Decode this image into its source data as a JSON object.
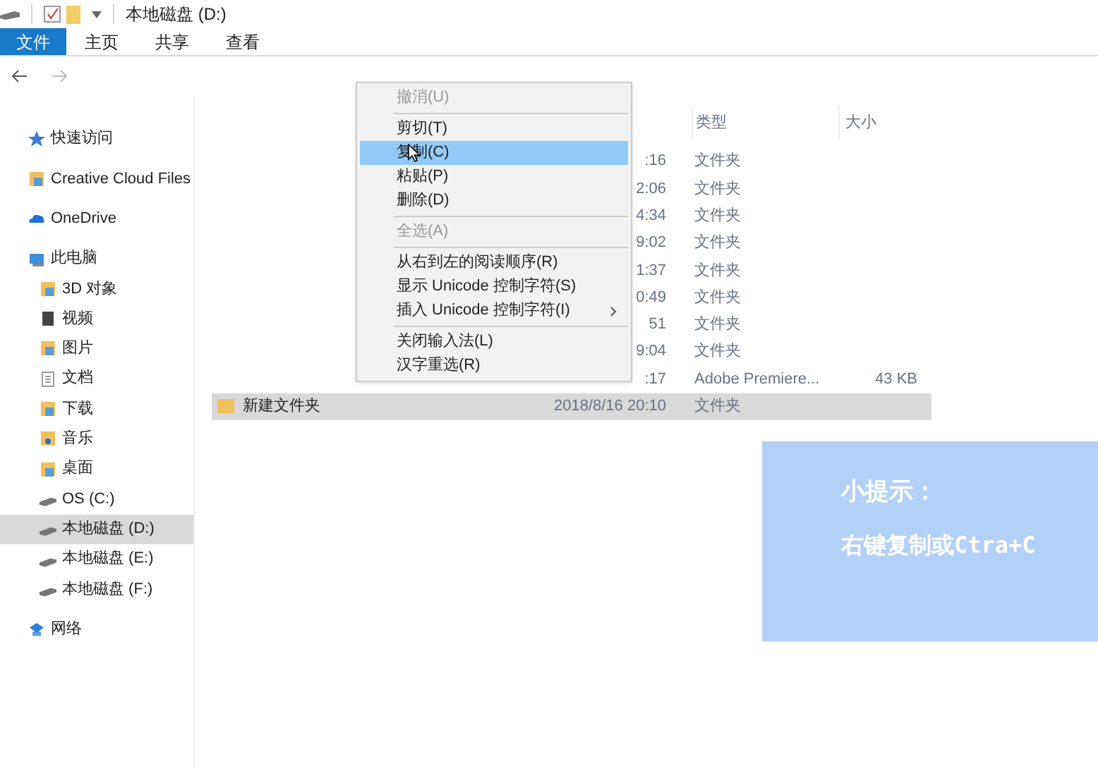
{
  "title_bar": {
    "title": "本地磁盘 (D:)"
  },
  "ribbon_tabs": [
    {
      "label": "文件",
      "kind": "file"
    },
    {
      "label": "主页",
      "kind": "tab"
    },
    {
      "label": "共享",
      "kind": "tab"
    },
    {
      "label": "查看",
      "kind": "tab"
    }
  ],
  "nav_pane": [
    {
      "label": "快速访问",
      "selected": false
    },
    {
      "label": "Creative Cloud Files",
      "selected": false
    },
    {
      "label": "OneDrive",
      "selected": false
    },
    {
      "label": "此电脑",
      "selected": false,
      "children": [
        {
          "label": "3D 对象",
          "selected": false
        },
        {
          "label": "视频",
          "selected": false
        },
        {
          "label": "图片",
          "selected": false
        },
        {
          "label": "文档",
          "selected": false
        },
        {
          "label": "下载",
          "selected": false
        },
        {
          "label": "音乐",
          "selected": false
        },
        {
          "label": "桌面",
          "selected": false
        },
        {
          "label": "OS (C:)",
          "selected": false
        },
        {
          "label": "本地磁盘 (D:)",
          "selected": true
        },
        {
          "label": "本地磁盘 (E:)",
          "selected": false
        },
        {
          "label": "本地磁盘 (F:)",
          "selected": false
        }
      ]
    },
    {
      "label": "网络",
      "selected": false
    }
  ],
  "columns": [
    {
      "label": "类型"
    },
    {
      "label": "大小"
    }
  ],
  "rows": [
    {
      "date": ":16",
      "type": "文件夹",
      "selected": false
    },
    {
      "date": "2:06",
      "type": "文件夹",
      "selected": false
    },
    {
      "date": "4:34",
      "type": "文件夹",
      "selected": false
    },
    {
      "date": "9:02",
      "type": "文件夹",
      "selected": false
    },
    {
      "date": "1:37",
      "type": "文件夹",
      "selected": false
    },
    {
      "date": "0:49",
      "type": "文件夹",
      "selected": false
    },
    {
      "date": "51",
      "type": "文件夹",
      "selected": false
    },
    {
      "date": "9:04",
      "type": "文件夹",
      "selected": false
    },
    {
      "date": ":17",
      "type": "Adobe Premiere...",
      "size": "43 KB",
      "selected": false
    },
    {
      "name": "新建文件夹",
      "date": "2018/8/16 20:10",
      "type": "文件夹",
      "selected": true
    }
  ],
  "context_menu": [
    {
      "kind": "item",
      "label": "撤消(U)",
      "disabled": true,
      "selected": false
    },
    {
      "kind": "separator"
    },
    {
      "kind": "item",
      "label": "剪切(T)",
      "disabled": false,
      "selected": false
    },
    {
      "kind": "item",
      "label": "复制(C)",
      "disabled": false,
      "selected": true
    },
    {
      "kind": "item",
      "label": "粘贴(P)",
      "disabled": false,
      "selected": false
    },
    {
      "kind": "item",
      "label": "删除(D)",
      "disabled": false,
      "selected": false
    },
    {
      "kind": "separator"
    },
    {
      "kind": "item",
      "label": "全选(A)",
      "disabled": true,
      "selected": false
    },
    {
      "kind": "separator"
    },
    {
      "kind": "item",
      "label": "从右到左的阅读顺序(R)",
      "disabled": false,
      "selected": false
    },
    {
      "kind": "item",
      "label": "显示 Unicode 控制字符(S)",
      "disabled": false,
      "selected": false
    },
    {
      "kind": "item",
      "label": "插入 Unicode 控制字符(I)",
      "disabled": false,
      "selected": false,
      "submenu": true
    },
    {
      "kind": "separator"
    },
    {
      "kind": "item",
      "label": "关闭输入法(L)",
      "disabled": false,
      "selected": false
    },
    {
      "kind": "item",
      "label": "汉字重选(R)",
      "disabled": false,
      "selected": false
    }
  ],
  "hint": {
    "title": "小提示：",
    "body": "右键复制或Ctra+C"
  }
}
